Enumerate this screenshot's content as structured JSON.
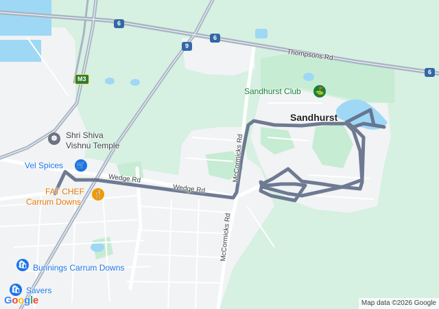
{
  "map": {
    "colors": {
      "land": "#d6f0e2",
      "urban": "#f1f3f4",
      "park": "#c6ecd3",
      "water": "#9ed8f5",
      "road": "#ffffff",
      "highway": "#a8b4c4",
      "route": "#5f6b87",
      "poi_food": "#f29900",
      "poi_shop": "#1a73e8",
      "poi_sport": "#188038",
      "poi_temple": "#6b7280"
    },
    "place_label": "Sandhurst",
    "roads": {
      "thompsons": "Thompsons Rd",
      "wedge_west": "Wedge Rd",
      "wedge_east": "Wedge Rd",
      "mccormicks_north": "McCormicks Rd",
      "mccormicks_south": "McCormicks Rd"
    },
    "shields": {
      "hwy_6_west": "6",
      "hwy_6_mid": "6",
      "hwy_6_east": "6",
      "hwy_9": "9",
      "m3": "M3"
    },
    "pois": {
      "sandhurst_club": "Sandhurst Club",
      "temple_line1": "Shri Shiva",
      "temple_line2": "Vishnu Temple",
      "vel_spices": "Vel Spices",
      "fat_chef_line1": "FAT CHEF",
      "fat_chef_line2": "Carrum Downs",
      "bunnings": "Bunnings Carrum Downs",
      "savers": "Savers"
    },
    "icons": {
      "golf": "golf-icon",
      "temple": "temple-icon",
      "shopping": "shopping-cart-icon",
      "restaurant": "restaurant-icon",
      "store": "shopping-bag-icon"
    },
    "logo": "Google",
    "attribution": "Map data ©2026 Google"
  }
}
